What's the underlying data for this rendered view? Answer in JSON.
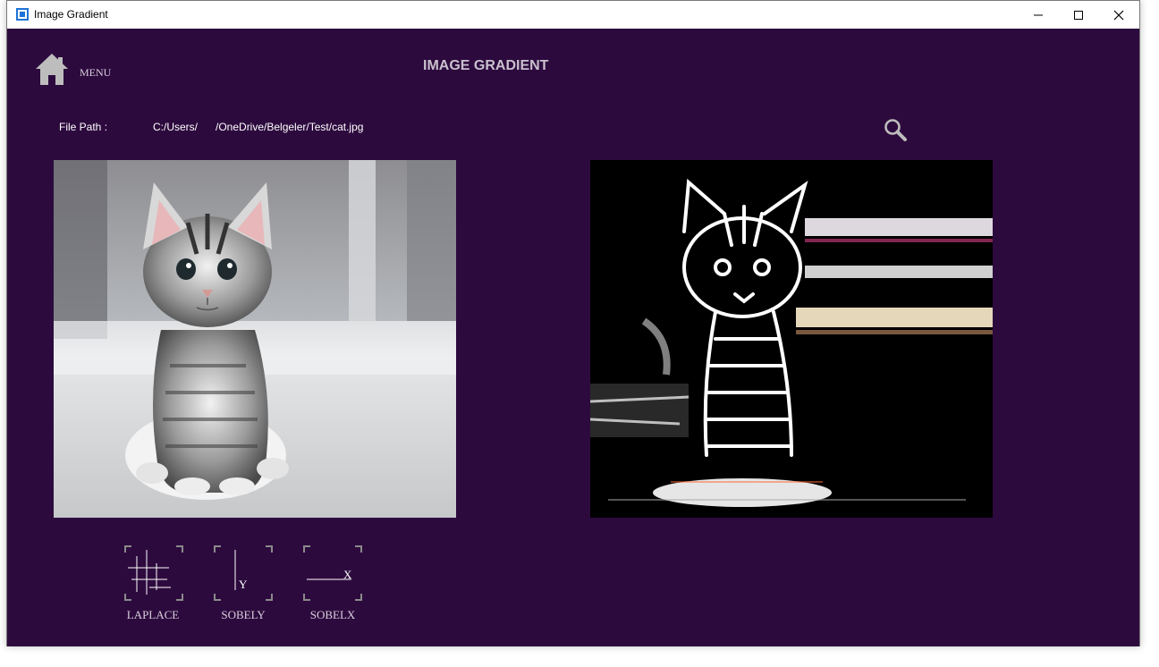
{
  "window": {
    "title": "Image Gradient",
    "controls": {
      "minimize": "minimize-icon",
      "maximize": "maximize-icon",
      "close": "close-icon"
    }
  },
  "header": {
    "home_icon": "home-icon",
    "menu_label": "MENU",
    "title": "IMAGE GRADIENT"
  },
  "file": {
    "label": "File Path :",
    "path": "C:/Users/      /OneDrive/Belgeler/Test/cat.jpg",
    "search_icon": "search-icon"
  },
  "images": {
    "original": "kitten photo",
    "result": "gradient-filtered kitten"
  },
  "filters": [
    {
      "label": "LAPLACE",
      "icon": "laplace-icon"
    },
    {
      "label": "SOBELY",
      "icon": "sobel-y-icon",
      "glyph": "Y"
    },
    {
      "label": "SOBELX",
      "icon": "sobel-x-icon",
      "glyph": "X"
    }
  ],
  "colors": {
    "background": "#2d0a3e",
    "text": "#d8d0dc",
    "title": "#c9c0cd"
  }
}
